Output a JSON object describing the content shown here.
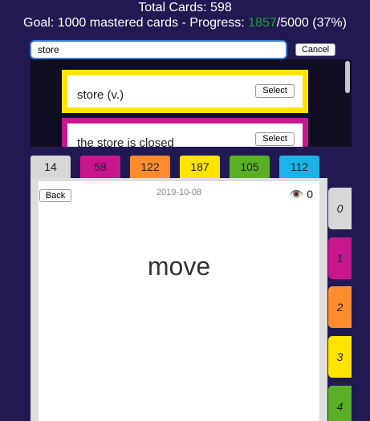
{
  "stats": {
    "total_label": "Total Cards: 598",
    "goal_prefix": "Goal: 1000 mastered cards - Progress: ",
    "mastered": "1857",
    "goal_suffix": "/5000 (37%)"
  },
  "search": {
    "value": "store",
    "cancel_label": "Cancel"
  },
  "results": [
    {
      "text": "store (v.)",
      "select_label": "Select",
      "color": "#ffe400"
    },
    {
      "text": "the store is closed",
      "select_label": "Select",
      "color": "#c7168e"
    }
  ],
  "counts": [
    {
      "value": "14",
      "color": "#d7d7d7"
    },
    {
      "value": "58",
      "color": "#c7168e"
    },
    {
      "value": "122",
      "color": "#ff8c2f"
    },
    {
      "value": "187",
      "color": "#ffe400"
    },
    {
      "value": "105",
      "color": "#59b025"
    },
    {
      "value": "112",
      "color": "#1eb3e6"
    }
  ],
  "card": {
    "back_label": "Back",
    "date": "2019-10-08",
    "view_count": "0",
    "eye_icon": "eye-icon",
    "word": "move"
  },
  "levels": [
    {
      "label": "0",
      "color": "#d7d7d7"
    },
    {
      "label": "1",
      "color": "#c7168e"
    },
    {
      "label": "2",
      "color": "#ff8c2f"
    },
    {
      "label": "3",
      "color": "#ffe400"
    },
    {
      "label": "4",
      "color": "#59b025"
    }
  ]
}
